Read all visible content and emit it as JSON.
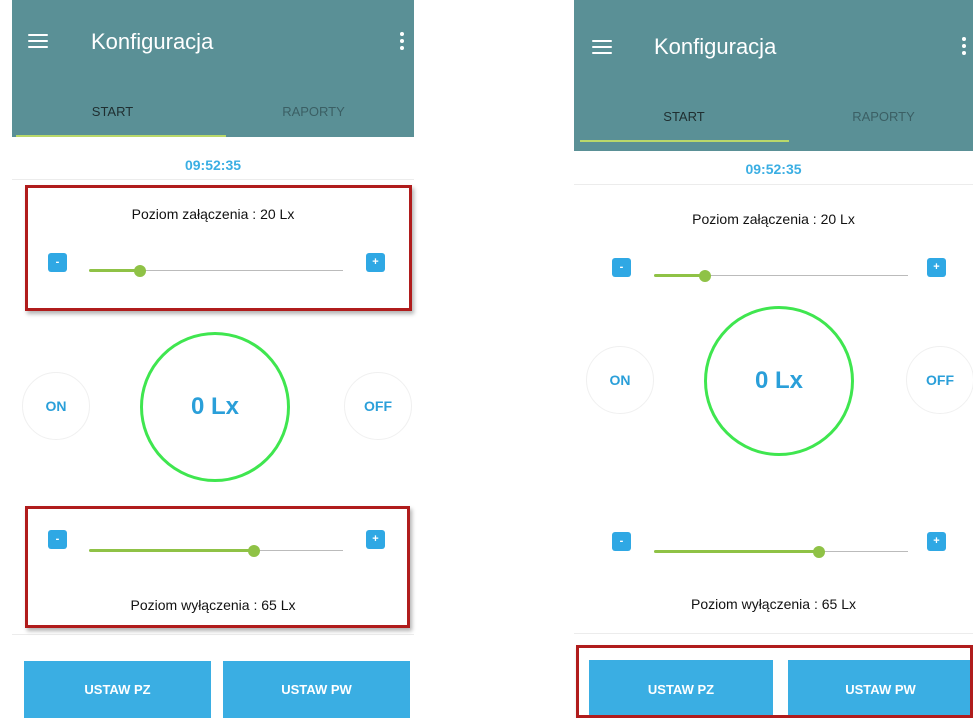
{
  "colors": {
    "appbar": "#5a9096",
    "accent": "#3aaee3",
    "slider_fill": "#8fc246",
    "indicator_circle": "#3fe64f",
    "highlight_border": "#b01c1c"
  },
  "screens": [
    {
      "appbar": {
        "title": "Konfiguracja",
        "menu_icon": "hamburger-menu-icon",
        "more_icon": "more-vert-icon"
      },
      "tabs": [
        {
          "label": "START",
          "active": true
        },
        {
          "label": "RAPORTY",
          "active": false
        }
      ],
      "clock": "09:52:35",
      "on_level": {
        "label": "Poziom załączenia : 20 Lx",
        "minus": "-",
        "plus": "+",
        "value": 0.2
      },
      "indicator": {
        "value_text": "0 Lx",
        "on_label": "ON",
        "off_label": "OFF"
      },
      "off_level": {
        "label": "Poziom wyłączenia : 65 Lx",
        "minus": "-",
        "plus": "+",
        "value": 0.65
      },
      "buttons": {
        "set_pz": "USTAW PZ",
        "set_pw": "USTAW PW"
      }
    },
    {
      "appbar": {
        "title": "Konfiguracja",
        "menu_icon": "hamburger-menu-icon",
        "more_icon": "more-vert-icon"
      },
      "tabs": [
        {
          "label": "START",
          "active": true
        },
        {
          "label": "RAPORTY",
          "active": false
        }
      ],
      "clock": "09:52:35",
      "on_level": {
        "label": "Poziom załączenia : 20 Lx",
        "minus": "-",
        "plus": "+",
        "value": 0.2
      },
      "indicator": {
        "value_text": "0 Lx",
        "on_label": "ON",
        "off_label": "OFF"
      },
      "off_level": {
        "label": "Poziom wyłączenia : 65 Lx",
        "minus": "-",
        "plus": "+",
        "value": 0.65
      },
      "buttons": {
        "set_pz": "USTAW PZ",
        "set_pw": "USTAW PW"
      }
    }
  ]
}
